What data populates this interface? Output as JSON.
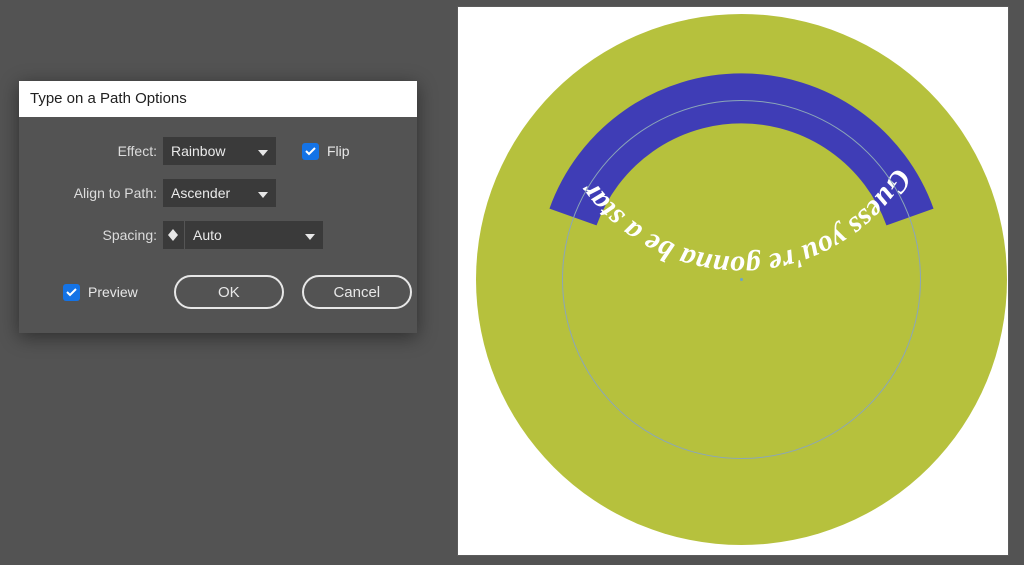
{
  "dialog": {
    "title": "Type on a Path Options",
    "rows": {
      "effect": {
        "label": "Effect:",
        "value": "Rainbow"
      },
      "flip": {
        "label": "Flip",
        "checked": true
      },
      "align": {
        "label": "Align to Path:",
        "value": "Ascender"
      },
      "spacing": {
        "label": "Spacing:",
        "value": "Auto"
      }
    },
    "preview": {
      "label": "Preview",
      "checked": true
    },
    "ok": "OK",
    "cancel": "Cancel"
  },
  "canvas": {
    "path_text": "Guess you're gonna be a star",
    "colors": {
      "disc": "#b6c13d",
      "arc": "#3f3db6",
      "text": "#ffffff"
    }
  }
}
